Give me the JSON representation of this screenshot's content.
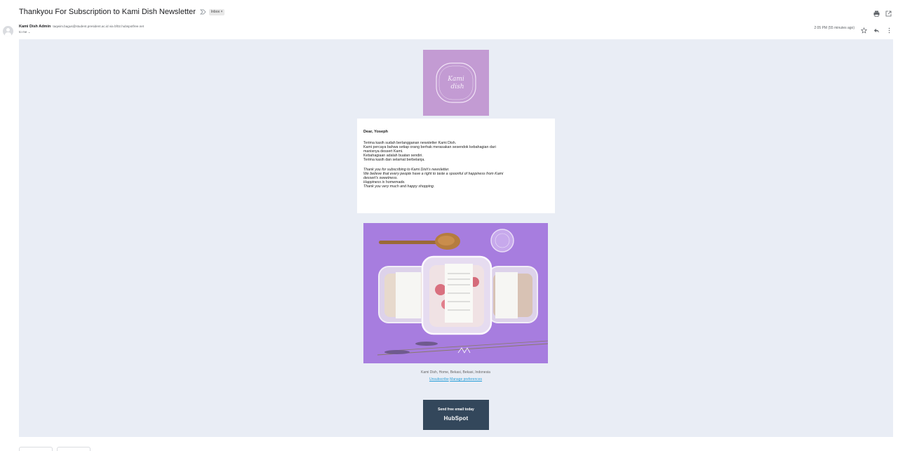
{
  "header": {
    "subject": "Thankyou For Subscription to Kami Dish Newsletter",
    "label": "Inbox ×"
  },
  "icons": {
    "print": "print-icon",
    "popout": "open-in-new-window-icon",
    "importance": "importance-marker-icon",
    "star": "star-icon",
    "reply": "reply-icon",
    "more": "more-vert-icon",
    "avatar": "default-avatar-icon"
  },
  "sender": {
    "name": "Kami Dish Admin",
    "email": "taqwim.bagus@student.president.ac.id via bf02.hubspotfree.net",
    "to": "to me ⌄",
    "timestamp": "2:05 PM (55 minutes ago)"
  },
  "email": {
    "logo_text_1": "Kami",
    "logo_text_2": "dish",
    "greeting": "Dear, Yoseph",
    "id_lines": [
      "Terima kasih sudah berlangganan newsletter Kami Dish.",
      "Kami percaya bahwa setiap orang berhak merasakan sesendok kebahagian dari",
      "manisnya dessert Kami.",
      "Kebahagiaan adalah buatan sendiri.",
      "Terima kasih dan selamat berbelanja."
    ],
    "en_lines": [
      "Thank you for subscribing to Kami Dish's newsletter.",
      "We believe that every people have a right to taste a spoonful of happiness from Kami",
      "dessert's sweetness.",
      "Happiness is homemade.",
      "Thank you very much and happy shopping."
    ],
    "address": "Kami Dish, Home, Bekasi, Bekasi, Indonesia",
    "unsubscribe": "Unsubscribe",
    "manage": "Manage preferences",
    "badge_line1": "Send free email today",
    "badge_line2": "HubSpot"
  },
  "colors": {
    "body_bg": "#e9edf5",
    "logo_bg": "#c39bd3",
    "photo_bg": "#a77ddf",
    "badge_bg": "#33475b",
    "link": "#2a9fd8"
  }
}
